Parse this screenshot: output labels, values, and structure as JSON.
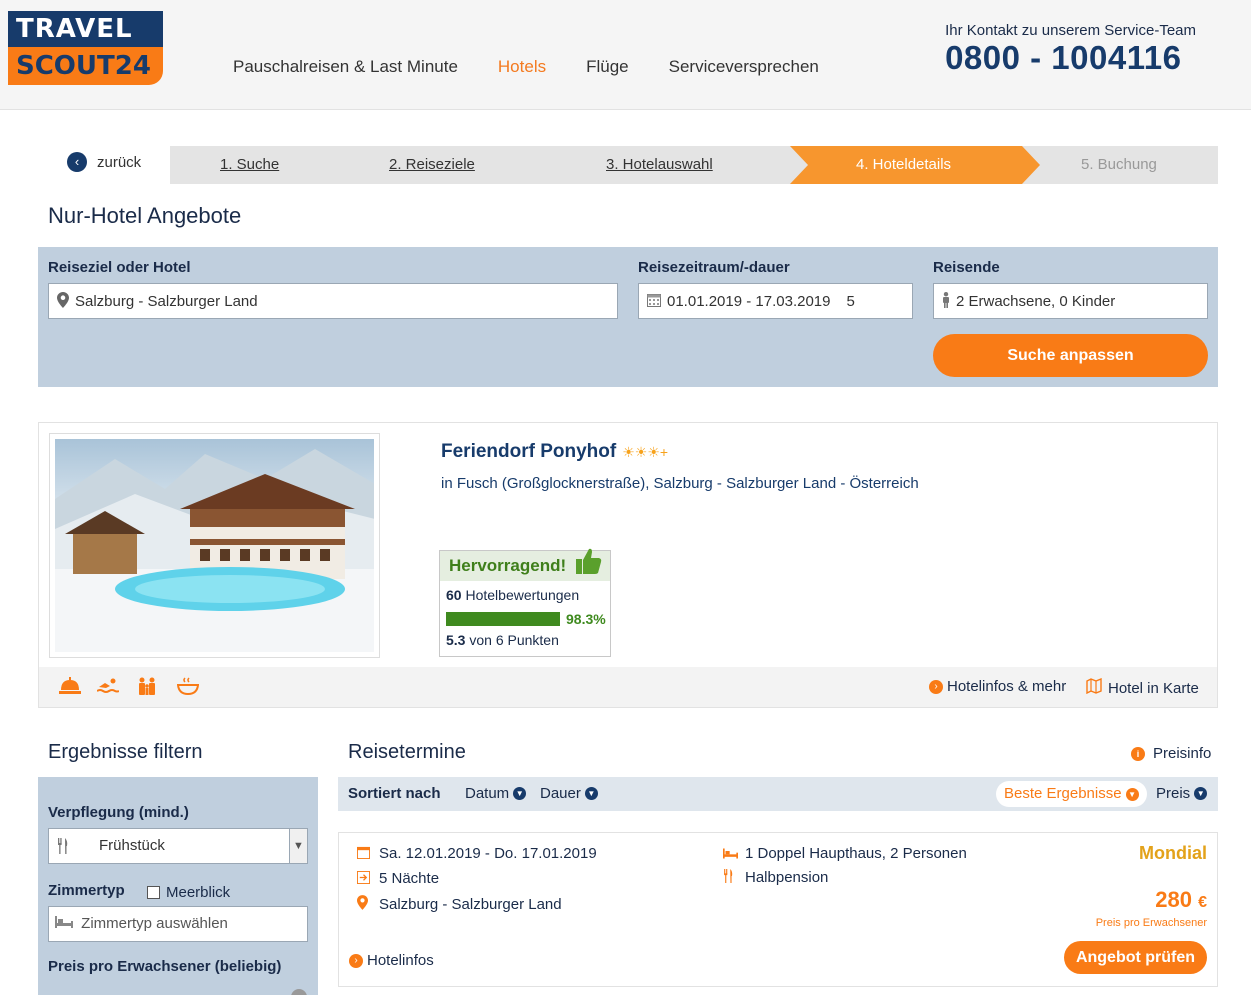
{
  "logo": {
    "line1": "TRAVEL",
    "line2": "SCOUT24"
  },
  "nav": {
    "items": [
      {
        "label": "Pauschalreisen & Last Minute"
      },
      {
        "label": "Hotels"
      },
      {
        "label": "Flüge"
      },
      {
        "label": "Serviceversprechen"
      }
    ],
    "active_color": "#f47a1f"
  },
  "contact": {
    "label": "Ihr Kontakt zu unserem Service-Team",
    "phone": "0800 - 1004116"
  },
  "steps": {
    "back": "zurück",
    "items": [
      "1. Suche",
      "2. Reiseziele",
      "3. Hotelauswahl",
      "4. Hoteldetails",
      "5. Buchung"
    ],
    "active_index": 3
  },
  "page_title": "Nur-Hotel Angebote",
  "search": {
    "destination_label": "Reiseziel oder Hotel",
    "destination_value": "Salzburg - Salzburger Land",
    "period_label": "Reisezeitraum/-dauer",
    "period_value": "01.01.2019 - 17.03.2019",
    "duration_value": "5",
    "travellers_label": "Reisende",
    "travellers_value": "2 Erwachsene, 0 Kinder",
    "button": "Suche anpassen"
  },
  "hotel": {
    "name": "Feriendorf Ponyhof",
    "stars": "☀☀☀+",
    "location": "in Fusch (Großglocknerstraße), Salzburg - Salzburger Land - Österreich",
    "rating_label": "Hervorragend!",
    "reviews_count": "60",
    "reviews_label": "Hotelbewertungen",
    "recommend_pct": "98.3%",
    "recommend_fraction": 0.983,
    "score": "5.3",
    "score_suffix": "von 6 Punkten",
    "amenities": [
      "reception-bell-icon",
      "swimming-icon",
      "family-icon",
      "wellness-bowl-icon"
    ],
    "link_info": "Hotelinfos & mehr",
    "link_map": "Hotel in Karte"
  },
  "filter": {
    "title": "Ergebnisse filtern",
    "board_label": "Verpflegung (mind.)",
    "board_value": "Frühstück",
    "room_label": "Zimmertyp",
    "seaview_label": "Meerblick",
    "room_placeholder": "Zimmertyp auswählen",
    "price_label": "Preis pro Erwachsener (beliebig)"
  },
  "results": {
    "title": "Reisetermine",
    "price_info": "Preisinfo",
    "sorted_by": "Sortiert nach",
    "sort_date": "Datum",
    "sort_duration": "Dauer",
    "sort_best": "Beste Ergebnisse",
    "sort_price": "Preis",
    "offer": {
      "dates": "Sa. 12.01.2019 - Do. 17.01.2019",
      "nights": "5 Nächte",
      "place": "Salzburg - Salzburger Land",
      "room": "1 Doppel Haupthaus, 2 Personen",
      "board": "Halbpension",
      "operator": "Mondial",
      "price": "280",
      "currency": "€",
      "price_note": "Preis pro Erwachsener",
      "button": "Angebot prüfen",
      "hotel_link": "Hotelinfos"
    }
  }
}
